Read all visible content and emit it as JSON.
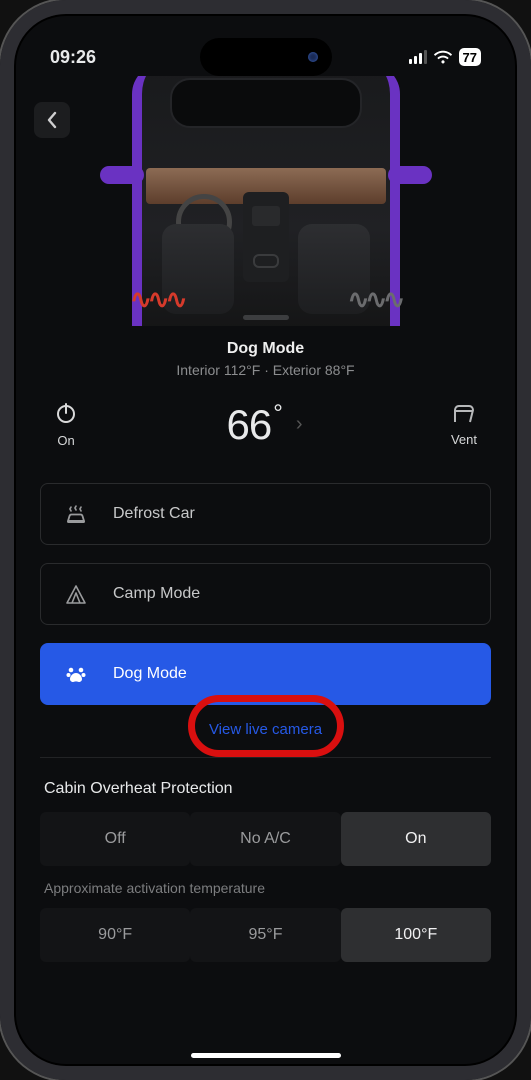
{
  "status_bar": {
    "time": "09:26",
    "battery": "77"
  },
  "header": {
    "mode_title": "Dog Mode",
    "temps_line": "Interior 112°F  ·  Exterior 88°F"
  },
  "controls": {
    "power_label": "On",
    "set_temp": "66",
    "vent_label": "Vent"
  },
  "modes": {
    "defrost": "Defrost Car",
    "camp": "Camp Mode",
    "dog": "Dog Mode"
  },
  "live_camera_link": "View live camera",
  "overheat": {
    "title": "Cabin Overheat Protection",
    "options": {
      "off": "Off",
      "noac": "No A/C",
      "on": "On"
    },
    "selected": "on"
  },
  "activation": {
    "label": "Approximate activation temperature",
    "options": {
      "t90": "90°F",
      "t95": "95°F",
      "t100": "100°F"
    },
    "selected": "t100"
  }
}
